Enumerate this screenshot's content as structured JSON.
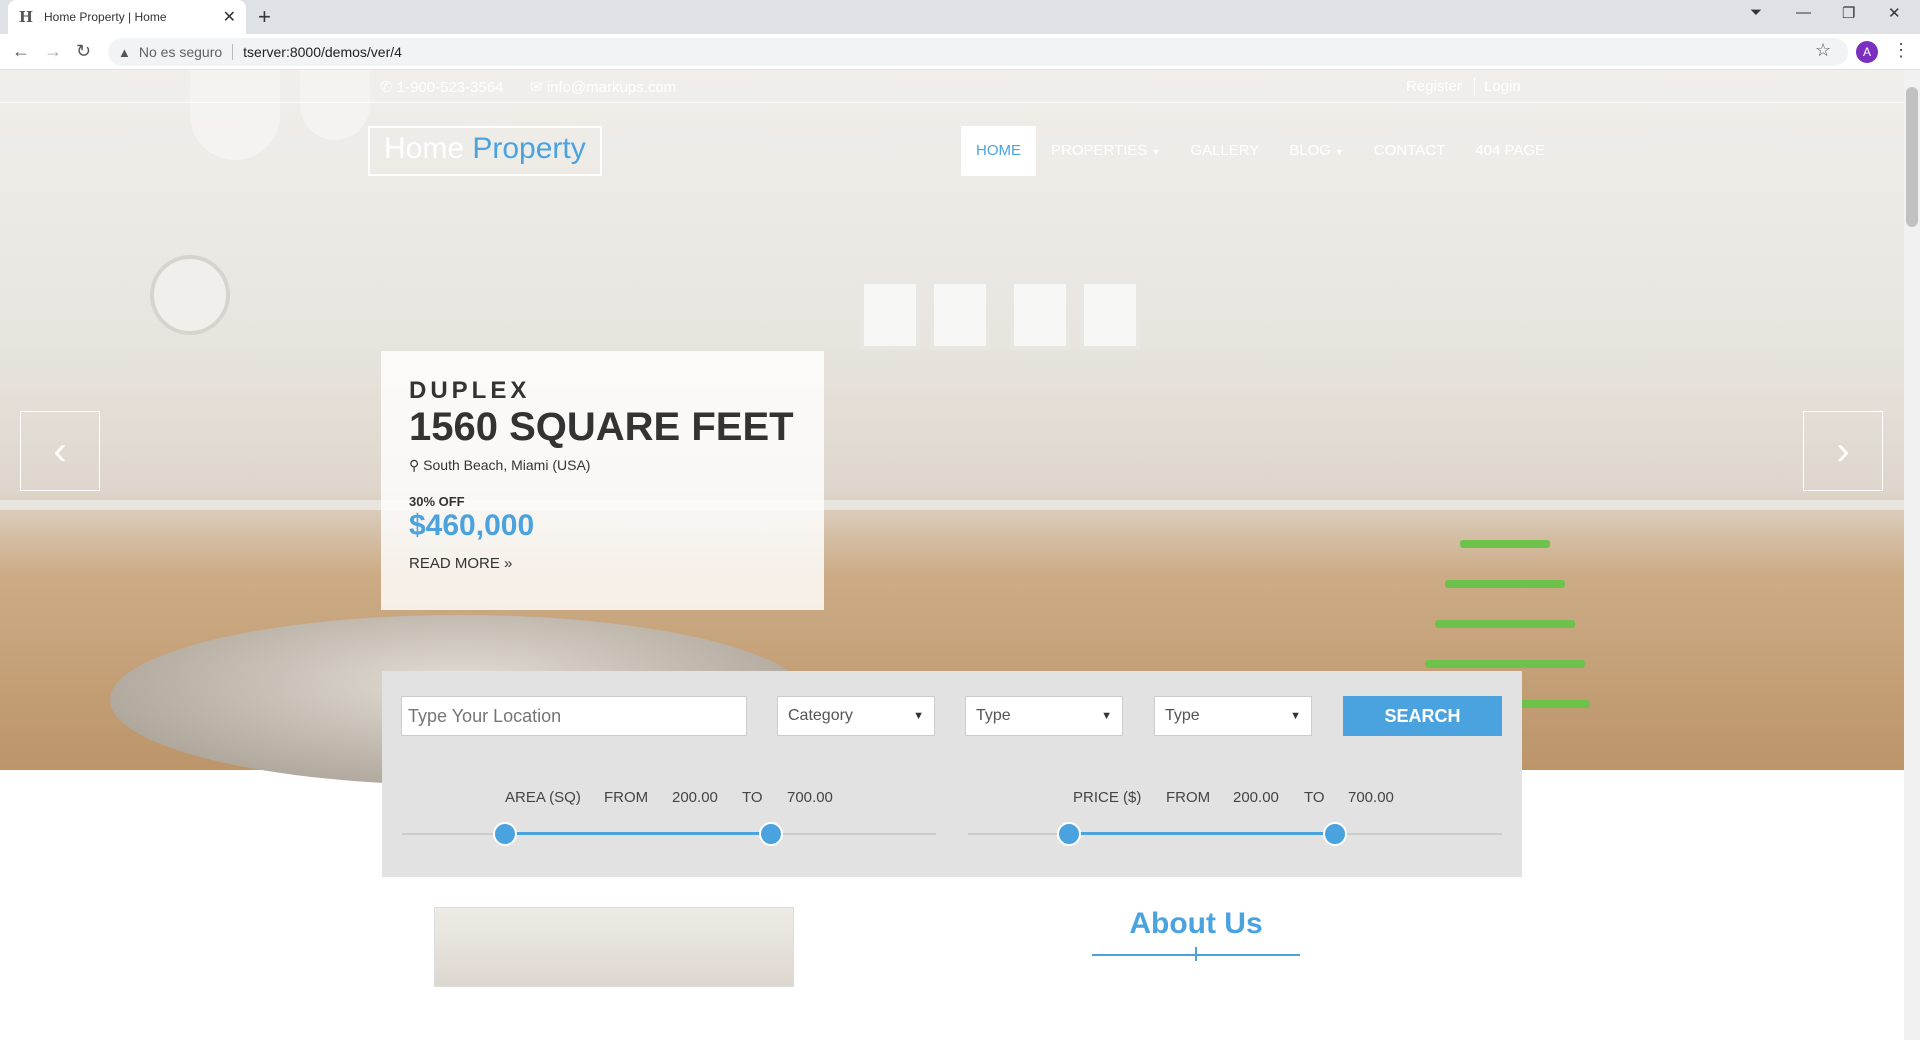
{
  "browser": {
    "tab_title": "Home Property | Home",
    "favicon": "H",
    "url_warning": "No es seguro",
    "url": "tserver:8000/demos/ver/4",
    "avatar_letter": "A"
  },
  "topbar": {
    "phone": "1-900-523-3564",
    "email": "info@markups.com",
    "register": "Register",
    "login": "Login"
  },
  "logo": {
    "part1": "Home ",
    "part2": "Property"
  },
  "nav": [
    {
      "label": "HOME",
      "active": true,
      "dropdown": false
    },
    {
      "label": "PROPERTIES",
      "active": false,
      "dropdown": true
    },
    {
      "label": "GALLERY",
      "active": false,
      "dropdown": false
    },
    {
      "label": "BLOG",
      "active": false,
      "dropdown": true
    },
    {
      "label": "CONTACT",
      "active": false,
      "dropdown": false
    },
    {
      "label": "404 PAGE",
      "active": false,
      "dropdown": false
    }
  ],
  "slide": {
    "kind": "DUPLEX",
    "size": "1560 SQUARE FEET",
    "location": "South Beach, Miami (USA)",
    "discount": "30% OFF",
    "price": "$460,000",
    "read_more": "READ MORE"
  },
  "search": {
    "location_placeholder": "Type Your Location",
    "category": "Category",
    "type1": "Type",
    "type2": "Type",
    "button": "SEARCH",
    "area": {
      "label": "AREA (SQ)",
      "from_label": "FROM",
      "from": "200.00",
      "to_label": "TO",
      "to": "700.00"
    },
    "price": {
      "label": "PRICE ($)",
      "from_label": "FROM",
      "from": "200.00",
      "to_label": "TO",
      "to": "700.00"
    }
  },
  "about": {
    "title": "About Us"
  },
  "colors": {
    "accent": "#4aa3df"
  }
}
